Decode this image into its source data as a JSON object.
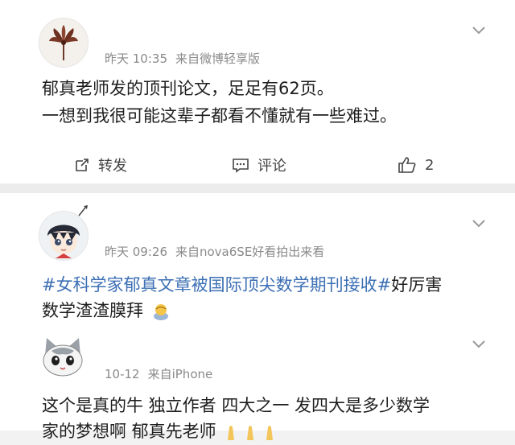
{
  "posts": [
    {
      "time": "昨天 10:35",
      "source": "来自微博轻享版",
      "lines": [
        "郁真老师发的顶刊论文，足足有62页。",
        "一想到我很可能这辈子都看不懂就有一些难过。"
      ],
      "actions": {
        "repost": "转发",
        "comment": "评论",
        "like_count": "2"
      }
    },
    {
      "time": "昨天 09:26",
      "source": "来自nova6SE好看拍出来看",
      "hashtag": "#女科学家郁真文章被国际顶尖数学期刊接收#",
      "line1_tail": "好厉害",
      "line2": "数学渣渣膜拜"
    },
    {
      "time": "10-12",
      "source": "来自iPhone",
      "line1": "这个是真的牛 独立作者 四大之一 发四大是多少数学",
      "line2": "家的梦想啊 郁真先老师"
    }
  ],
  "icons": {
    "post1_avatar": "flower-avatar-icon",
    "post2_avatar": "anime-boy-avatar-icon",
    "post3_avatar": "cat-avatar-icon",
    "chevron": "chevron-down-icon",
    "repost": "repost-icon",
    "comment": "comment-icon",
    "like": "thumbs-up-icon",
    "emoji_bow": "bow-emoji-icon",
    "emoji_hands": "raised-hands-emoji-icon"
  },
  "colors": {
    "hashtag": "#3c6fb4",
    "meta": "#8a8a8a"
  }
}
